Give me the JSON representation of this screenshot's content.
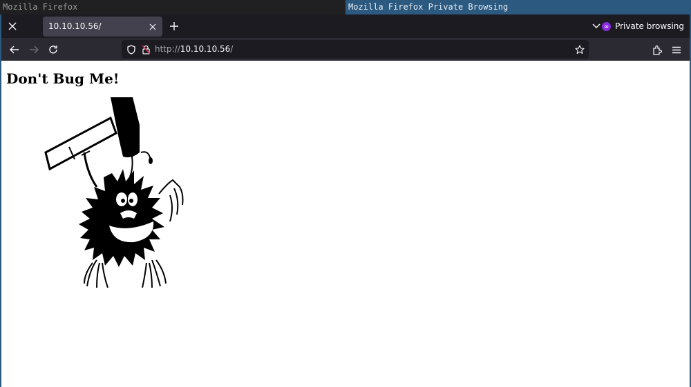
{
  "taskbar": {
    "tasks": [
      {
        "label": "Mozilla Firefox",
        "active": false
      },
      {
        "label": "Mozilla Firefox Private Browsing",
        "active": true
      }
    ]
  },
  "browser": {
    "tabs": [
      {
        "title": "10.10.10.56/",
        "active": true
      }
    ],
    "private_label": "Private browsing",
    "url": {
      "scheme": "http://",
      "host": "10.10.10.56",
      "path": "/"
    },
    "icons": {
      "close_window": "close-icon",
      "new_tab": "plus-icon",
      "tab_list": "chevron-down-icon",
      "private": "private-mask-icon",
      "back": "arrow-left-icon",
      "forward": "arrow-right-icon",
      "reload": "reload-icon",
      "tracking": "shield-icon",
      "insecure": "insecure-lock-icon",
      "bookmark": "star-icon",
      "extensions": "puzzle-icon",
      "menu": "hamburger-menu-icon"
    }
  },
  "page": {
    "heading": "Don't Bug Me!",
    "image_alt": "cartoon bug holding a hammer"
  }
}
